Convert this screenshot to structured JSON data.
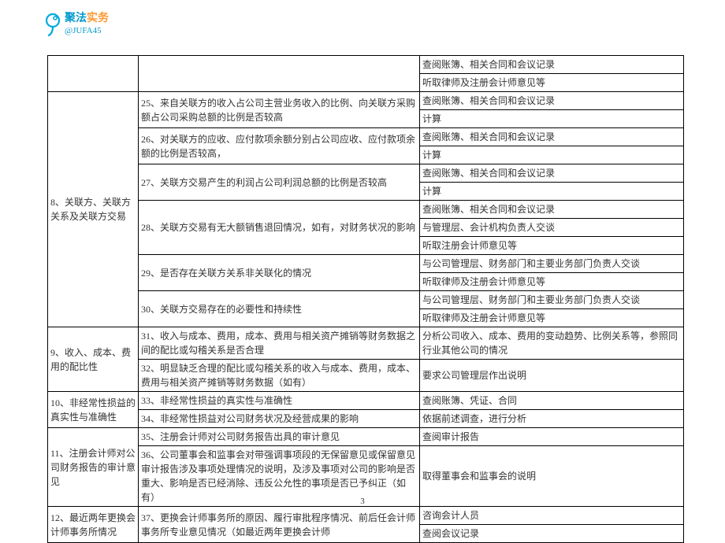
{
  "logo": {
    "brand_blue": "聚法",
    "brand_orange": "实务",
    "handle": "@JUFA45"
  },
  "table": {
    "blank0": "",
    "r0c3": "查阅账簿、相关合同和会议记录",
    "r1c3": "听取律师及注册会计师意见等",
    "sec8_label": "8、关联方、关联方关系及关联方交易",
    "sec8_25": "25、来自关联方的收入占公司主营业务收入的比例、向关联方采购额占公司采购总额的比例是否较高",
    "sec8_25_a": "查阅账簿、相关合同和会议记录",
    "sec8_25_b": "计算",
    "sec8_26": "26、对关联方的应收、应付款项余额分别占公司应收、应付款项余额的比例是否较高，",
    "sec8_26_a": "查阅账簿、相关合同和会议记录",
    "sec8_26_b": "计算",
    "sec8_27": "27、关联方交易产生的利润占公司利润总额的比例是否较高",
    "sec8_27_a": "查阅账簿、相关合同和会议记录",
    "sec8_27_b": "计算",
    "sec8_28": "28、关联方交易有无大额销售退回情况，如有，对财务状况的影响",
    "sec8_28_a": "查阅账簿、相关合同和会议记录",
    "sec8_28_b": "与管理层、会计机构负责人交谈",
    "sec8_28_c": "听取注册会计师意见等",
    "sec8_29": "29、是否存在关联方关系非关联化的情况",
    "sec8_29_a": "与公司管理层、财务部门和主要业务部门负责人交谈",
    "sec8_29_b": "听取律师及注册会计师意见等",
    "sec8_30": "30、关联方交易存在的必要性和持续性",
    "sec8_30_a": "与公司管理层、财务部门和主要业务部门负责人交谈",
    "sec8_30_b": "听取律师及注册会计师意见等",
    "sec9_label": "9、收入、成本、费用的配比性",
    "sec9_31": "31、收入与成本、费用，成本、费用与相关资产摊销等财务数据之间的配比或勾稽关系是否合理",
    "sec9_31_a": "分析公司收入、成本、费用的变动趋势、比例关系等，参照同行业其他公司的情况",
    "sec9_32": "32、明显缺乏合理的配比或勾稽关系的收入与成本、费用，成本、费用与相关资产摊销等财务数据（如有）",
    "sec9_32_a": "要求公司管理层作出说明",
    "sec10_label": "10、非经常性损益的真实性与准确性",
    "sec10_33": "33、非经常性损益的真实性与准确性",
    "sec10_33_a": "查阅账簿、凭证、合同",
    "sec10_34": "34、非经常性损益对公司财务状况及经营成果的影响",
    "sec10_34_a": "依据前述调查，进行分析",
    "sec11_label": "11、注册会计师对公司财务报告的审计意见",
    "sec11_35": "35、注册会计师对公司财务报告出具的审计意见",
    "sec11_35_a": "查阅审计报告",
    "sec11_36": "36、公司董事会和监事会对带强调事项段的无保留意见或保留意见审计报告涉及事项处理情况的说明，及涉及事项对公司的影响是否重大、影响是否已经消除、违反公允性的事项是否已予纠正（如有）",
    "sec11_36_a": "取得董事会和监事会的说明",
    "sec12_label": "12、最近两年更换会计师事务所情况",
    "sec12_37": "37、更换会计师事务所的原因、履行审批程序情况、前后任会计师事务所专业意见情况（如最近两年更换会计师",
    "sec12_37_a": "咨询会计人员",
    "sec12_37_b": "查阅会议记录"
  },
  "page_number": "3"
}
